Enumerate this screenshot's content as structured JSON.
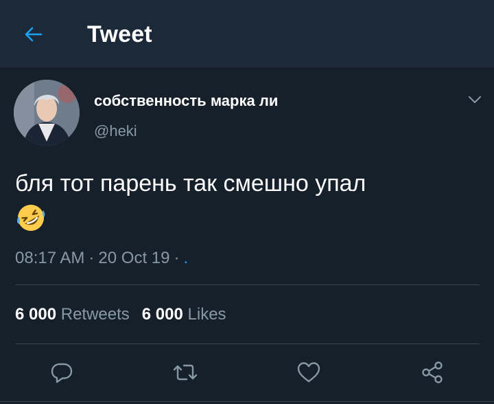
{
  "header": {
    "title": "Tweet",
    "back_icon": "arrow-left-icon",
    "accent": "#1da1f2"
  },
  "tweet": {
    "author": {
      "display_name": "собственность марка ли",
      "handle": "@heki",
      "avatar": "avatar"
    },
    "text": "бля тот парень так смешно упал",
    "emoji": "rolling-on-the-floor-laughing",
    "time": "08:17 AM",
    "separator": "·",
    "date": "20 Oct 19",
    "source": "."
  },
  "stats": {
    "retweets_count": "6 000",
    "retweets_label": "Retweets",
    "likes_count": "6 000",
    "likes_label": "Likes"
  },
  "actions": {
    "reply": "reply-icon",
    "retweet": "retweet-icon",
    "like": "heart-icon",
    "share": "share-icon"
  },
  "colors": {
    "background": "#15202b",
    "header_background": "#1c2938",
    "secondary_text": "#8899a6",
    "divider": "#38444d"
  }
}
